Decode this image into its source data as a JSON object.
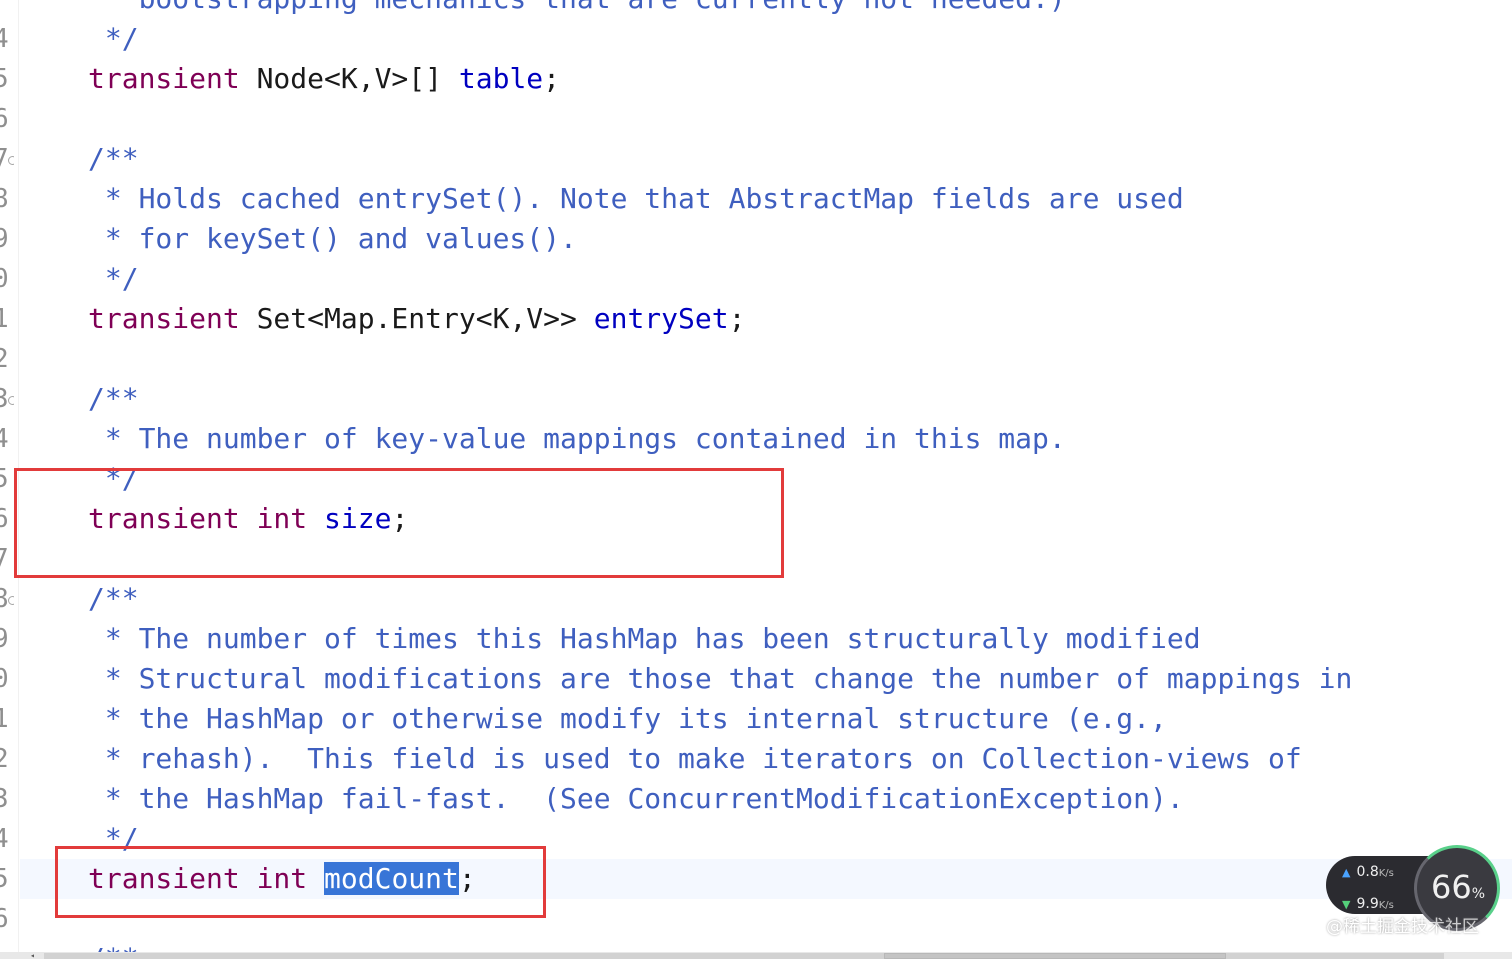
{
  "gutter": {
    "line_digits": [
      "4",
      "5",
      "6",
      "7",
      "8",
      "9",
      "0",
      "1",
      "2",
      "3",
      "4",
      "5",
      "6",
      "7",
      "8",
      "9",
      "0",
      "1",
      "2",
      "3",
      "4",
      "5",
      "6"
    ]
  },
  "code_lines": [
    {
      "segments": [
        {
          "t": "cm",
          "text": " * bootstrapping mechanics that are currently not needed.)"
        }
      ]
    },
    {
      "segments": [
        {
          "t": "cm",
          "text": " */"
        }
      ]
    },
    {
      "segments": [
        {
          "t": "kw",
          "text": "transient"
        },
        {
          "t": "plain",
          "text": " Node<K,V>[] "
        },
        {
          "t": "fld",
          "text": "table"
        },
        {
          "t": "plain",
          "text": ";"
        }
      ]
    },
    {
      "segments": []
    },
    {
      "segments": [
        {
          "t": "cm",
          "text": "/**"
        }
      ]
    },
    {
      "segments": [
        {
          "t": "cm",
          "text": " * Holds cached entrySet(). Note that AbstractMap fields are used"
        }
      ]
    },
    {
      "segments": [
        {
          "t": "cm",
          "text": " * for keySet() and values()."
        }
      ]
    },
    {
      "segments": [
        {
          "t": "cm",
          "text": " */"
        }
      ]
    },
    {
      "segments": [
        {
          "t": "kw",
          "text": "transient"
        },
        {
          "t": "plain",
          "text": " Set<Map.Entry<K,V>> "
        },
        {
          "t": "fld",
          "text": "entrySet"
        },
        {
          "t": "plain",
          "text": ";"
        }
      ]
    },
    {
      "segments": []
    },
    {
      "segments": [
        {
          "t": "cm",
          "text": "/**"
        }
      ]
    },
    {
      "segments": [
        {
          "t": "cm",
          "text": " * The number of key-value mappings contained in this map."
        }
      ]
    },
    {
      "segments": [
        {
          "t": "cm",
          "text": " */"
        }
      ]
    },
    {
      "segments": [
        {
          "t": "kw",
          "text": "transient"
        },
        {
          "t": "plain",
          "text": " "
        },
        {
          "t": "kw",
          "text": "int"
        },
        {
          "t": "plain",
          "text": " "
        },
        {
          "t": "fld",
          "text": "size"
        },
        {
          "t": "plain",
          "text": ";"
        }
      ]
    },
    {
      "segments": []
    },
    {
      "segments": [
        {
          "t": "cm",
          "text": "/**"
        }
      ]
    },
    {
      "segments": [
        {
          "t": "cm",
          "text": " * The number of times this HashMap has been structurally modified"
        }
      ]
    },
    {
      "segments": [
        {
          "t": "cm",
          "text": " * Structural modifications are those that change the number of mappings in"
        }
      ]
    },
    {
      "segments": [
        {
          "t": "cm",
          "text": " * the HashMap or otherwise modify its internal structure (e.g.,"
        }
      ]
    },
    {
      "segments": [
        {
          "t": "cm",
          "text": " * rehash).  This field is used to make iterators on Collection-views of"
        }
      ]
    },
    {
      "segments": [
        {
          "t": "cm",
          "text": " * the HashMap fail-fast.  (See ConcurrentModificationException)."
        }
      ]
    },
    {
      "segments": [
        {
          "t": "cm",
          "text": " */"
        }
      ]
    },
    {
      "segments": [
        {
          "t": "kw",
          "text": "transient"
        },
        {
          "t": "plain",
          "text": " "
        },
        {
          "t": "kw",
          "text": "int"
        },
        {
          "t": "plain",
          "text": " "
        },
        {
          "t": "sel",
          "text": "modCount"
        },
        {
          "t": "plain",
          "text": ";"
        }
      ]
    },
    {
      "segments": []
    },
    {
      "segments": [
        {
          "t": "cm",
          "text": "/**"
        }
      ]
    }
  ],
  "colors": {
    "keyword": "#7f0055",
    "field": "#0000c0",
    "javadoc": "#3f5fbf",
    "selection": "#3875d7",
    "annotation_box": "#e23b3b"
  },
  "net_widget": {
    "upload_value": "0.8",
    "upload_unit": "K/s",
    "download_value": "9.9",
    "download_unit": "K/s",
    "gauge_value": "66",
    "gauge_unit": "%"
  },
  "watermark": "@稀土掘金技术社区",
  "icons": {
    "upload": "arrow-up-icon",
    "download": "arrow-down-icon",
    "fold": "fold-marker-icon"
  }
}
